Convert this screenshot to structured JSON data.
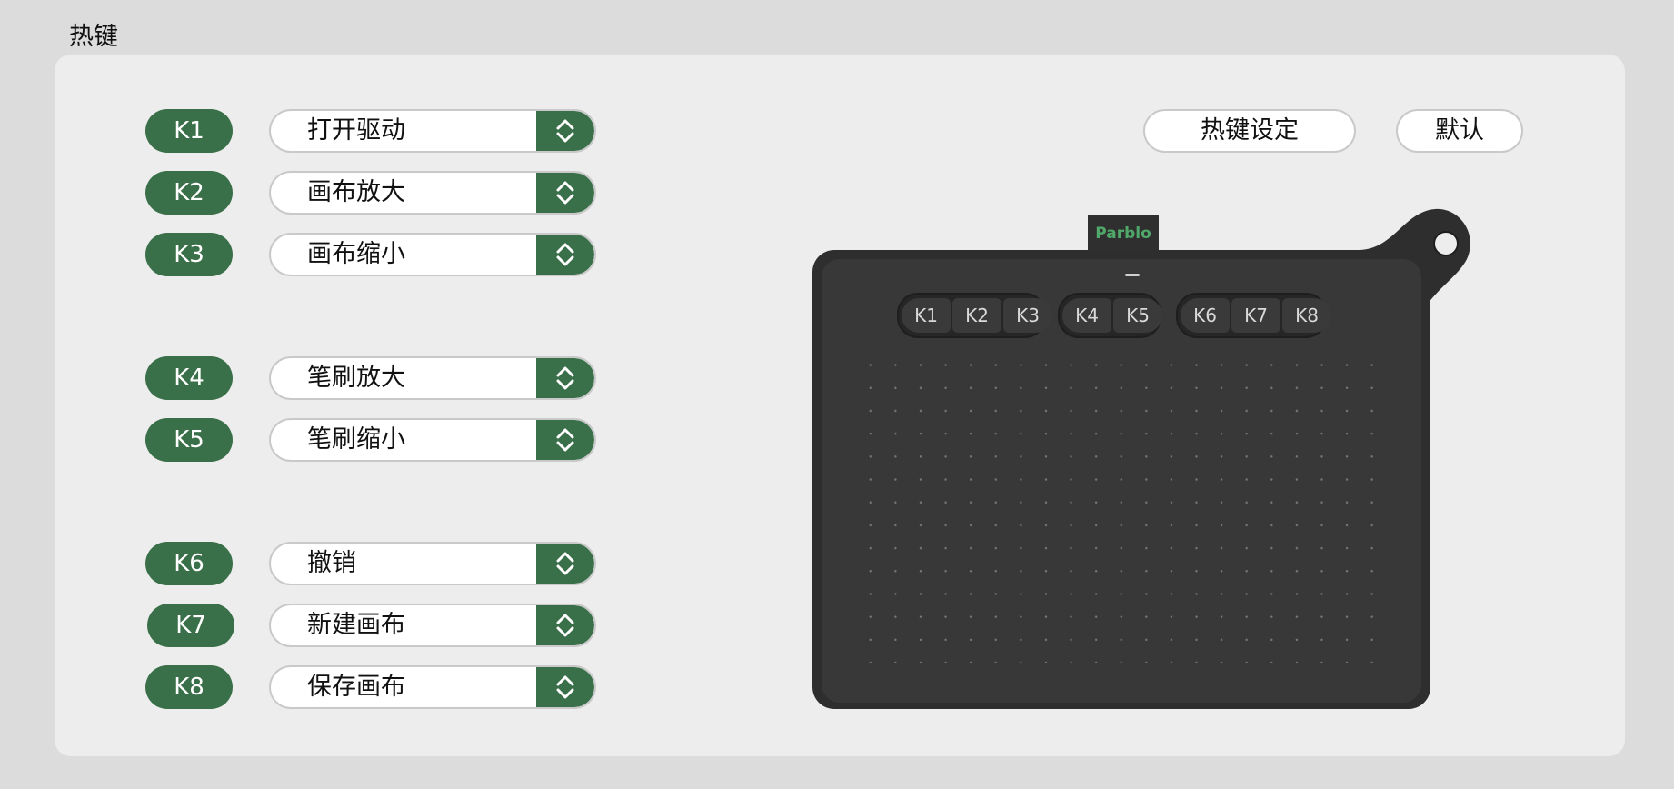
{
  "page_title": "热键",
  "hotkeys": [
    {
      "key": "K1",
      "value": "打开驱动"
    },
    {
      "key": "K2",
      "value": "画布放大"
    },
    {
      "key": "K3",
      "value": "画布缩小"
    },
    {
      "key": "K4",
      "value": "笔刷放大"
    },
    {
      "key": "K5",
      "value": "笔刷缩小"
    },
    {
      "key": "K6",
      "value": "撤销"
    },
    {
      "key": "K7",
      "value": "新建画布"
    },
    {
      "key": "K8",
      "value": "保存画布"
    }
  ],
  "buttons": {
    "hotkey_settings": "热键设定",
    "default": "默认"
  },
  "tablet": {
    "brand": "Parblo",
    "keys": [
      "K1",
      "K2",
      "K3",
      "K4",
      "K5",
      "K6",
      "K7",
      "K8"
    ]
  },
  "colors": {
    "accent": "#3a7049",
    "tablet": "#2e2e2e",
    "background": "#dcdcdc",
    "panel": "#ededed"
  },
  "icons": {
    "select": "chevron-up-down-icon"
  }
}
